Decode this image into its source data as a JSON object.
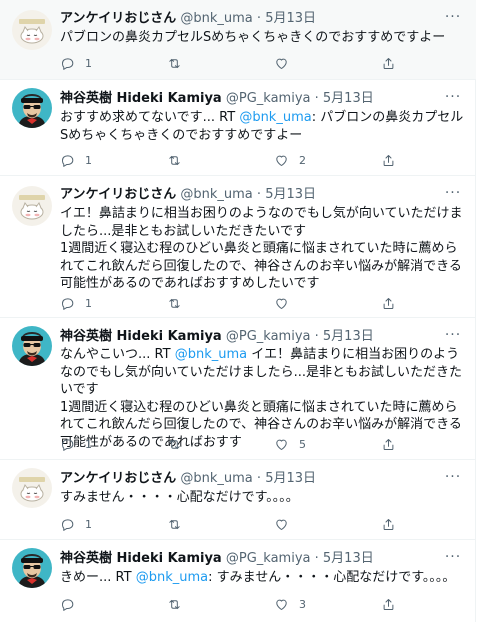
{
  "tweets": [
    {
      "name": "アンケイリおじさん",
      "handle": "@bnk_uma",
      "dot": "·",
      "date": "5月13日",
      "text": "パブロンの鼻炎カプセルSめちゃくちゃきくのでおすすめですよー",
      "reply_count": "1",
      "retweet_count": "",
      "like_count": "",
      "avatar": "sleeping-cat-avatar"
    },
    {
      "name": "神谷英樹 Hideki Kamiya",
      "handle": "@PG_kamiya",
      "dot": "·",
      "date": "5月13日",
      "text_pre": "おすすめ求めてないです... RT ",
      "text_link": "@bnk_uma",
      "text_post": ": パブロンの鼻炎カプセルSめちゃくちゃきくのでおすすめですよー",
      "reply_count": "1",
      "retweet_count": "",
      "like_count": "2",
      "avatar": "sunglasses-man-avatar"
    },
    {
      "name": "アンケイリおじさん",
      "handle": "@bnk_uma",
      "dot": "·",
      "date": "5月13日",
      "text": "イエ！鼻詰まりに相当お困りのようなのでもし気が向いていただけましたら...是非ともお試しいただきたいです\n1週間近く寝込む程のひどい鼻炎と頭痛に悩まされていた時に薦められてこれ飲んだら回復したので、神谷さんのお辛い悩みが解消できる可能性があるのであればおすすめしたいです",
      "reply_count": "1",
      "retweet_count": "",
      "like_count": "",
      "avatar": "sleeping-cat-avatar"
    },
    {
      "name": "神谷英樹 Hideki Kamiya",
      "handle": "@PG_kamiya",
      "dot": "·",
      "date": "5月13日",
      "text_pre": "なんやこいつ... RT ",
      "text_link": "@bnk_uma",
      "text_post": " イエ！鼻詰まりに相当お困りのようなのでもし気が向いていただけましたら...是非ともお試しいただきたいです\n1週間近く寝込む程のひどい鼻炎と頭痛に悩まされていた時に薦められてこれ飲んだら回復したので、神谷さんのお辛い悩みが解消できる可能性があるのであればおすす",
      "reply_count": "1",
      "retweet_count": "",
      "like_count": "5",
      "avatar": "sunglasses-man-avatar"
    },
    {
      "name": "アンケイリおじさん",
      "handle": "@bnk_uma",
      "dot": "·",
      "date": "5月13日",
      "text": "すみません・・・・心配なだけです。。。。",
      "reply_count": "1",
      "retweet_count": "",
      "like_count": "",
      "avatar": "sleeping-cat-avatar"
    },
    {
      "name": "神谷英樹 Hideki Kamiya",
      "handle": "@PG_kamiya",
      "dot": "·",
      "date": "5月13日",
      "text_pre": "きめー... RT ",
      "text_link": "@bnk_uma",
      "text_post": ": すみません・・・・心配なだけです。。。。",
      "reply_count": "",
      "retweet_count": "",
      "like_count": "3",
      "avatar": "sunglasses-man-avatar"
    }
  ],
  "icons": {
    "reply": "reply-icon",
    "retweet": "retweet-icon",
    "like": "like-icon",
    "share": "share-icon",
    "more": "more-icon"
  },
  "colors": {
    "link": "#1d9bf0",
    "secondary_text": "#536471",
    "highlight_bg": "#f7f9f9"
  }
}
